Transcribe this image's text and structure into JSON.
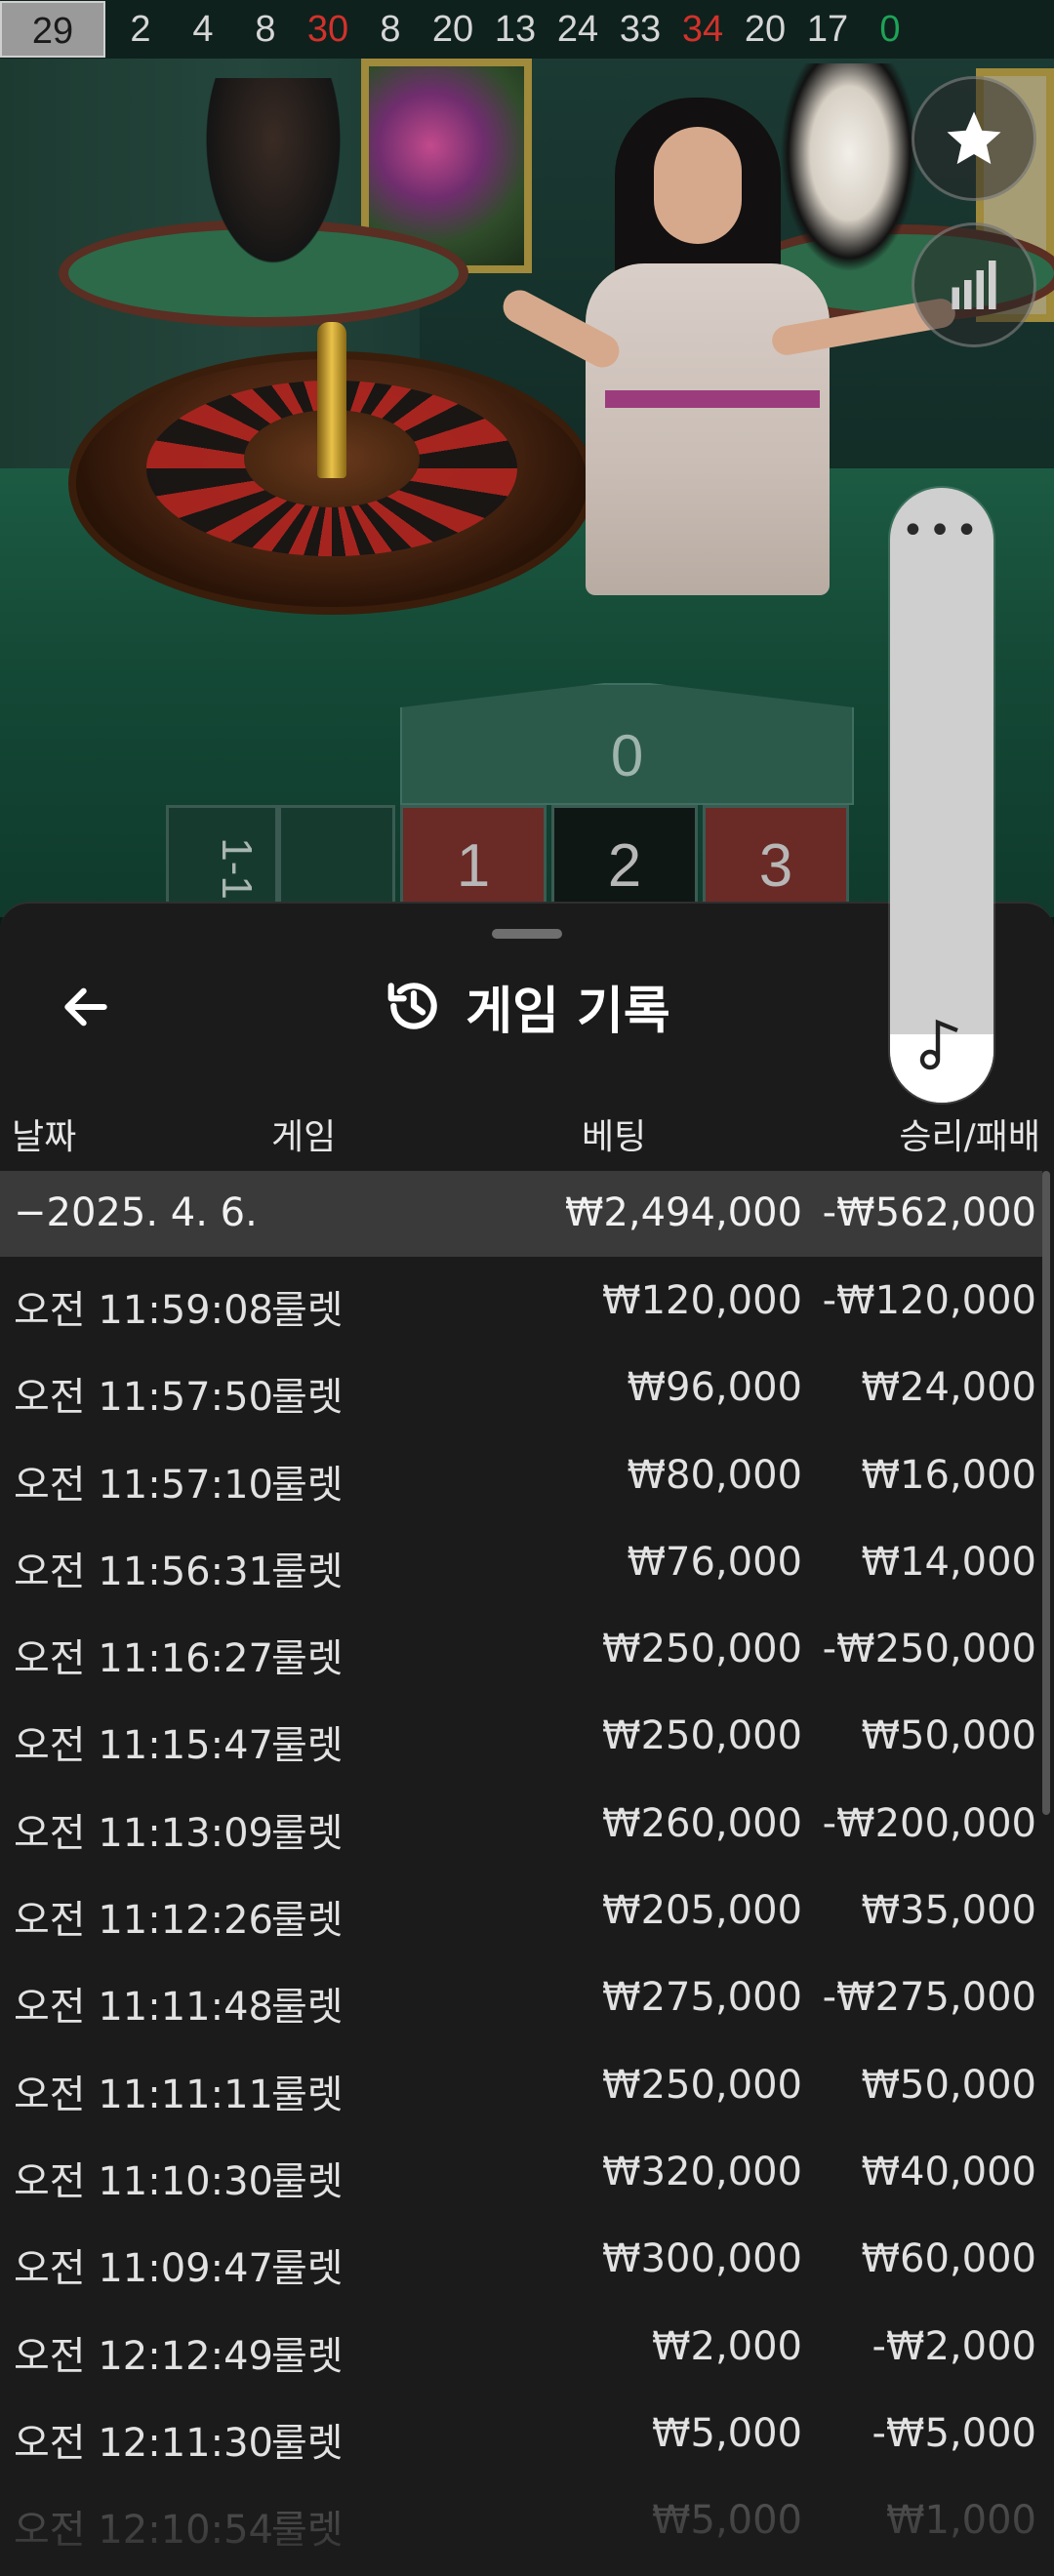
{
  "results": [
    {
      "value": "29",
      "color": "gray",
      "highlight": true
    },
    {
      "value": "2",
      "color": "white"
    },
    {
      "value": "4",
      "color": "white"
    },
    {
      "value": "8",
      "color": "white"
    },
    {
      "value": "30",
      "color": "red"
    },
    {
      "value": "8",
      "color": "white"
    },
    {
      "value": "20",
      "color": "white"
    },
    {
      "value": "13",
      "color": "white"
    },
    {
      "value": "24",
      "color": "white"
    },
    {
      "value": "33",
      "color": "white"
    },
    {
      "value": "34",
      "color": "red"
    },
    {
      "value": "20",
      "color": "white"
    },
    {
      "value": "17",
      "color": "white"
    },
    {
      "value": "0",
      "color": "green"
    }
  ],
  "board": {
    "zero": "0",
    "cells": [
      "1",
      "2",
      "3"
    ],
    "side_label": "1-1"
  },
  "icons": {
    "favorite": "star-icon",
    "statistics": "bar-chart-icon",
    "more": "more-dots-icon",
    "sound": "music-note-icon",
    "back": "arrow-left-icon",
    "history": "history-icon"
  },
  "history": {
    "title": "게임 기록",
    "columns": {
      "date": "날짜",
      "game": "게임",
      "bet": "베팅",
      "win_loss": "승리/패배"
    },
    "date_summary": {
      "date": "−2025. 4. 6.",
      "bet": "₩2,494,000",
      "win_loss": "-₩562,000"
    },
    "rows": [
      {
        "time": "오전 11:59:08",
        "game": "룰렛",
        "bet": "₩120,000",
        "win_loss": "-₩120,000"
      },
      {
        "time": "오전 11:57:50",
        "game": "룰렛",
        "bet": "₩96,000",
        "win_loss": "₩24,000"
      },
      {
        "time": "오전 11:57:10",
        "game": "룰렛",
        "bet": "₩80,000",
        "win_loss": "₩16,000"
      },
      {
        "time": "오전 11:56:31",
        "game": "룰렛",
        "bet": "₩76,000",
        "win_loss": "₩14,000"
      },
      {
        "time": "오전 11:16:27",
        "game": "룰렛",
        "bet": "₩250,000",
        "win_loss": "-₩250,000"
      },
      {
        "time": "오전 11:15:47",
        "game": "룰렛",
        "bet": "₩250,000",
        "win_loss": "₩50,000"
      },
      {
        "time": "오전 11:13:09",
        "game": "룰렛",
        "bet": "₩260,000",
        "win_loss": "-₩200,000"
      },
      {
        "time": "오전 11:12:26",
        "game": "룰렛",
        "bet": "₩205,000",
        "win_loss": "₩35,000"
      },
      {
        "time": "오전 11:11:48",
        "game": "룰렛",
        "bet": "₩275,000",
        "win_loss": "-₩275,000"
      },
      {
        "time": "오전 11:11:11",
        "game": "룰렛",
        "bet": "₩250,000",
        "win_loss": "₩50,000"
      },
      {
        "time": "오전 11:10:30",
        "game": "룰렛",
        "bet": "₩320,000",
        "win_loss": "₩40,000"
      },
      {
        "time": "오전 11:09:47",
        "game": "룰렛",
        "bet": "₩300,000",
        "win_loss": "₩60,000"
      },
      {
        "time": "오전 12:12:49",
        "game": "룰렛",
        "bet": "₩2,000",
        "win_loss": "-₩2,000"
      },
      {
        "time": "오전 12:11:30",
        "game": "룰렛",
        "bet": "₩5,000",
        "win_loss": "-₩5,000"
      },
      {
        "time": "오전 12:10:54",
        "game": "룰렛",
        "bet": "₩5,000",
        "win_loss": "₩1,000",
        "faded": true
      }
    ]
  }
}
